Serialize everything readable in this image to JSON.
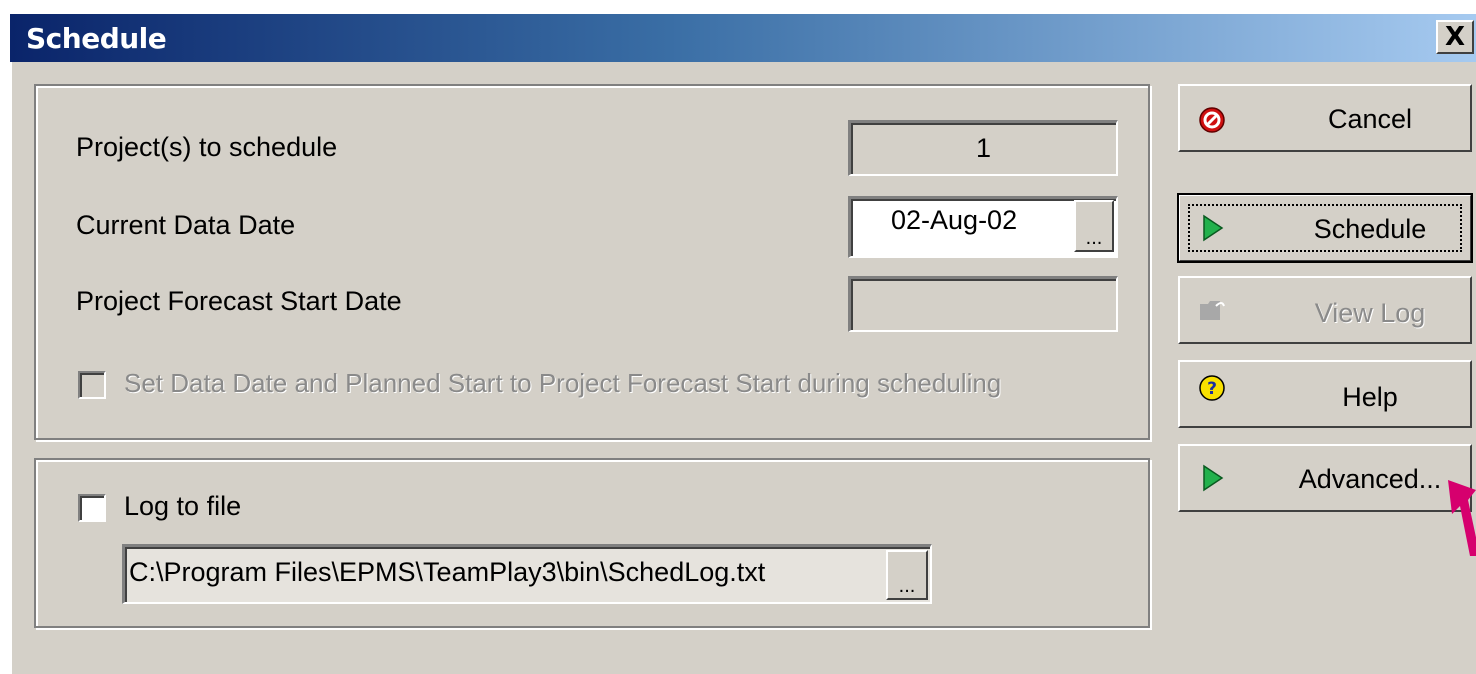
{
  "window": {
    "title": "Schedule",
    "close_glyph": "X"
  },
  "main_group": {
    "projects_label": "Project(s) to schedule",
    "projects_value": "1",
    "data_date_label": "Current Data Date",
    "data_date_value": "02-Aug-02",
    "data_date_browse": "...",
    "forecast_label": "Project Forecast Start Date",
    "forecast_value": "",
    "set_data_date_label": "Set Data Date and Planned Start to Project Forecast Start during scheduling",
    "set_data_date_checked": false,
    "set_data_date_enabled": false
  },
  "log_group": {
    "log_to_file_label": "Log to file",
    "log_to_file_checked": false,
    "log_path": "C:\\Program Files\\EPMS\\TeamPlay3\\bin\\SchedLog.txt",
    "log_path_browse": "..."
  },
  "buttons": {
    "cancel": {
      "label": "Cancel",
      "icon": "stop-icon",
      "enabled": true
    },
    "schedule": {
      "label": "Schedule",
      "icon": "play-triangle-icon",
      "enabled": true,
      "default": true
    },
    "view_log": {
      "label": "View Log",
      "icon": "folder-icon",
      "enabled": false
    },
    "help": {
      "label": "Help",
      "icon": "question-icon",
      "enabled": true
    },
    "advanced": {
      "label": "Advanced...",
      "icon": "play-triangle-icon",
      "enabled": true
    }
  },
  "colors": {
    "titlebar_start": "#0a246a",
    "titlebar_end": "#a6caf0",
    "dialog_bg": "#d4d0c8",
    "play_green": "#22b14c",
    "stop_red": "#d01010",
    "help_yellow": "#f8e000",
    "help_blue": "#1a2fa0",
    "pointer_arrow": "#d6006e"
  }
}
